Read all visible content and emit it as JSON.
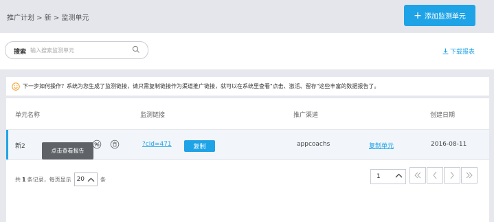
{
  "breadcrumb": "推广计划 > 新 > 监测单元",
  "add_button": {
    "plus": "+",
    "label": "添加监测单元"
  },
  "search": {
    "label": "搜索",
    "placeholder": "输入搜索监测单元"
  },
  "download_label": "下载报表",
  "tip": "下一步如何操作？系统为您生成了监测链接，请只需复制链接作为渠道推广链接，就可以在系统里查看\"点击、激活、留存\"这些丰富的数据报告了。",
  "table": {
    "headers": [
      "单元名称",
      "监测链接",
      "推广渠道",
      "创建日期"
    ],
    "rows": [
      {
        "name": "新2",
        "link": "?cid=471",
        "copy_label": "复制",
        "channel": "appcoachs",
        "copy_unit_label": "复制单元",
        "date": "2016-08-11"
      }
    ]
  },
  "tooltip": "点击查看报告",
  "footer": {
    "total_prefix": "共",
    "total_count": "1",
    "total_mid": "条记录，每页显示",
    "page_size": "20",
    "total_suffix": "条",
    "current_page": "1"
  },
  "colors": {
    "accent": "#1fa3e7",
    "tip_icon": "#f39a1f"
  }
}
